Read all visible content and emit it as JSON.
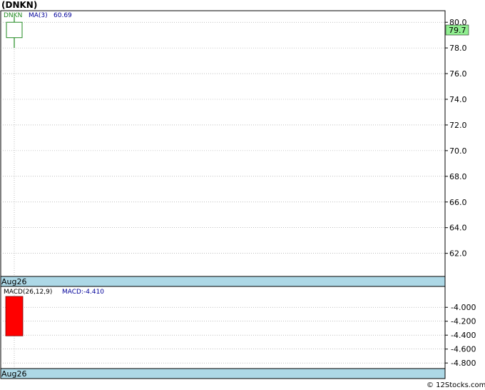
{
  "title": "(DNKN)",
  "footer": "© 12Stocks.com",
  "price_panel": {
    "ticker_label": "DNKN",
    "ma_label": "MA(3)",
    "ma_value": "60.69",
    "last_price": "79.7",
    "date_label": "Aug26"
  },
  "macd_panel": {
    "label": "MACD(26,12,9)",
    "value_label": "MACD:-4.410",
    "date_label": "Aug26"
  },
  "colors": {
    "up_candle": "#228B22",
    "price_badge": "#90EE90",
    "macd_bar": "#FF0000",
    "date_band": "#ADD8E6",
    "ma_text": "#000099",
    "grid": "#999999"
  },
  "chart_data": [
    {
      "type": "candlestick",
      "x": [
        "Aug26"
      ],
      "open": [
        78.8
      ],
      "close": [
        80.0
      ],
      "high": [
        80.5
      ],
      "low": [
        78.0
      ],
      "ylim": [
        60.2,
        80.9
      ],
      "yticks": [
        "80.0",
        "78.0",
        "76.0",
        "74.0",
        "72.0",
        "70.0",
        "68.0",
        "66.0",
        "64.0",
        "62.0"
      ],
      "grid": true
    },
    {
      "type": "bar",
      "categories": [
        "Aug26"
      ],
      "values": [
        -4.41
      ],
      "ylim": [
        -4.88,
        -3.7
      ],
      "yticks": [
        "-4.000",
        "-4.200",
        "-4.400",
        "-4.600",
        "-4.800"
      ],
      "grid": true
    }
  ]
}
